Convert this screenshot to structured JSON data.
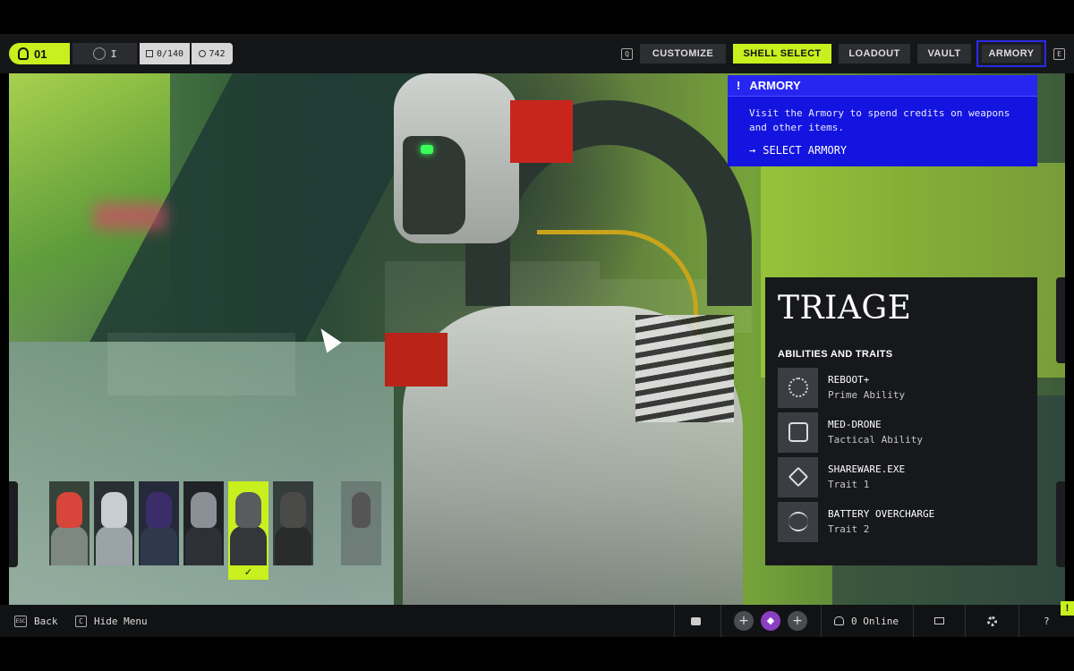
{
  "topbar": {
    "level": "01",
    "rank": "I",
    "item_count": "0/140",
    "credits": "742",
    "key_left": "Q",
    "key_right": "E",
    "nav": {
      "customize": "CUSTOMIZE",
      "shell_select": "SHELL SELECT",
      "loadout": "LOADOUT",
      "vault": "VAULT",
      "armory": "ARMORY"
    },
    "active_tab": "shell_select",
    "accent_color": "#c8f01e"
  },
  "armory_popup": {
    "marker": "!",
    "title": "ARMORY",
    "body": "Visit the Armory to spend credits on weapons and other items.",
    "action_arrow": "→",
    "action": "SELECT ARMORY",
    "color": "#1414e0"
  },
  "shell": {
    "name": "TRIAGE",
    "section_title": "ABILITIES AND TRAITS",
    "abilities": [
      {
        "name": "REBOOT+",
        "type": "Prime Ability",
        "icon": "reboot-icon"
      },
      {
        "name": "MED-DRONE",
        "type": "Tactical Ability",
        "icon": "med-drone-icon"
      },
      {
        "name": "SHAREWARE.EXE",
        "type": "Trait 1",
        "icon": "shareware-icon"
      },
      {
        "name": "BATTERY OVERCHARGE",
        "type": "Trait 2",
        "icon": "battery-overcharge-icon"
      }
    ]
  },
  "shell_selector": {
    "selected_index": 4,
    "selected_mark": "✓",
    "count": 7
  },
  "bottombar": {
    "back_key": "ESC",
    "back_label": "Back",
    "hide_key": "C",
    "hide_label": "Hide Menu",
    "party_add_1": "+",
    "party_add_2": "+",
    "online_count": "0 Online",
    "help": "?",
    "alert": "!"
  }
}
